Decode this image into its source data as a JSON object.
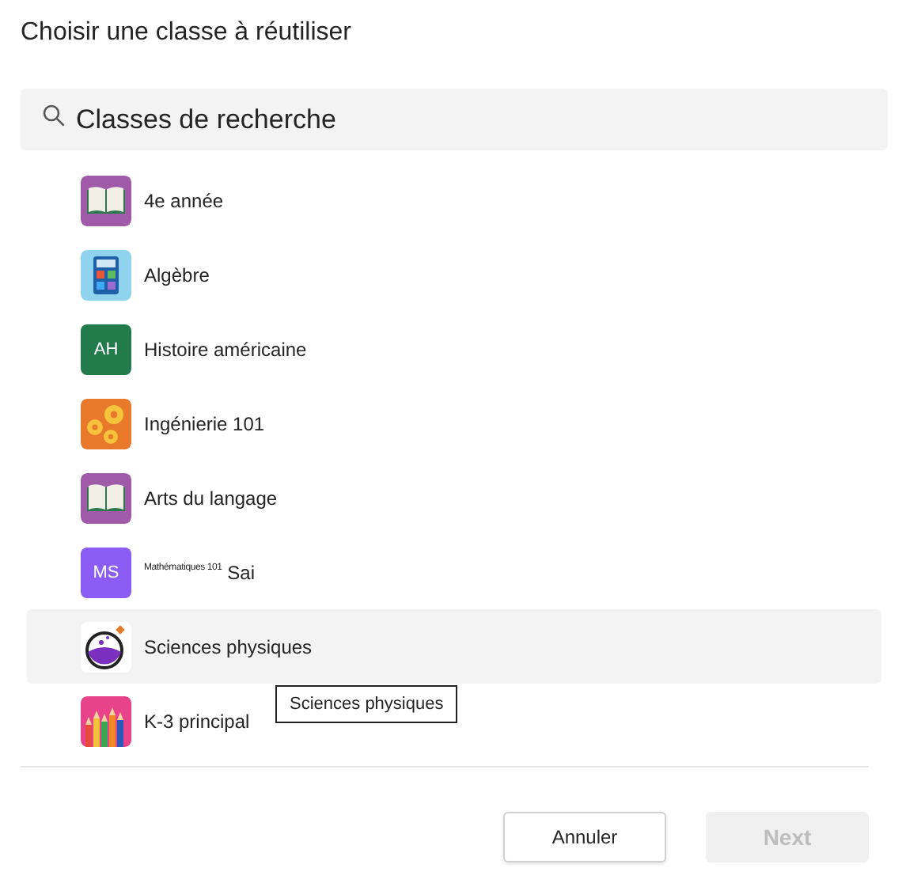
{
  "dialog": {
    "title": "Choisir une classe à réutiliser"
  },
  "search": {
    "placeholder": "Classes de recherche"
  },
  "classes": [
    {
      "name": "4e année",
      "kind": "book",
      "selected": false
    },
    {
      "name": "Algèbre",
      "kind": "calculator",
      "selected": false
    },
    {
      "name": "Histoire américaine",
      "kind": "initials",
      "initials": "AH",
      "color": "#237b4b",
      "selected": false
    },
    {
      "name": "Ingénierie 101",
      "kind": "gears",
      "selected": false
    },
    {
      "name": "Arts du langage",
      "kind": "book",
      "selected": false
    },
    {
      "name": "$^{Mathématiques 101}$ Sai",
      "kind": "initials",
      "initials": "MS",
      "color": "#8b5cf6",
      "selected": false
    },
    {
      "name": "Sciences physiques",
      "kind": "flask",
      "selected": true
    },
    {
      "name": "K-3 principal",
      "kind": "pencils",
      "selected": false
    }
  ],
  "tooltip": {
    "text": "Sciences physiques"
  },
  "buttons": [
    {
      "label": "Annuler",
      "kind": "secondary",
      "disabled": false
    },
    {
      "label": "Next",
      "kind": "primary",
      "disabled": true
    }
  ]
}
